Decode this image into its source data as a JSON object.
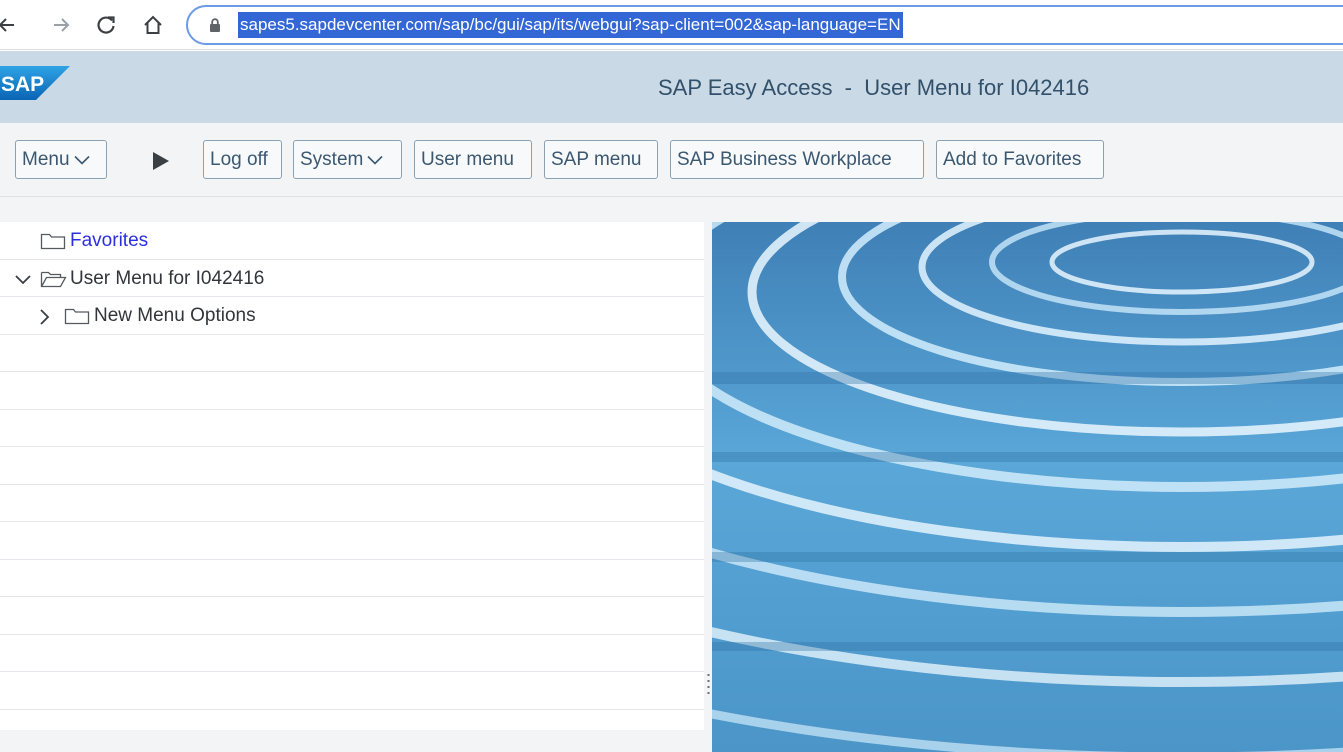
{
  "browser": {
    "url": "sapes5.sapdevcenter.com/sap/bc/gui/sap/its/webgui?sap-client=002&sap-language=EN"
  },
  "header": {
    "logo_text": "SAP",
    "title": "SAP Easy Access  -  User Menu for I042416"
  },
  "toolbar": {
    "menu_label": "Menu",
    "logoff_label": "Log off",
    "system_label": "System",
    "user_menu_label": "User menu",
    "sap_menu_label": "SAP menu",
    "workplace_label": "SAP Business Workplace",
    "favorites_label": "Add to Favorites"
  },
  "tree": {
    "favorites": "Favorites",
    "user_menu": "User Menu for I042416",
    "new_menu_options": "New Menu Options"
  },
  "colors": {
    "header_bg": "#c9d9e6",
    "toolbar_bg": "#f2f4f6",
    "url_highlight": "#3367d6",
    "link": "#2b2fe0"
  }
}
